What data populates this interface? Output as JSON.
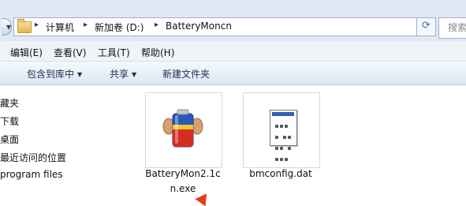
{
  "address": {
    "path": [
      "计算机",
      "新加卷 (D:)",
      "BatteryMoncn"
    ],
    "search_placeholder": "搜索"
  },
  "menu": [
    "编辑(E)",
    "查看(V)",
    "工具(T)",
    "帮助(H)"
  ],
  "commands": [
    "包含到库中",
    "共享",
    "新建文件夹"
  ],
  "nav_items": [
    "藏夹",
    "下载",
    "桌面",
    "最近访问的位置",
    "program files"
  ],
  "files": [
    {
      "name_line1": "BatteryMon2.1c",
      "name_line2": "n.exe",
      "icon": "battery-app-icon"
    },
    {
      "name_line1": "bmconfig.dat",
      "name_line2": "",
      "icon": "document-icon"
    }
  ],
  "colors": {
    "address_bar": "#dfe9f5",
    "command_bar": "#dbe6f3",
    "arrow": "#e53b1e"
  }
}
